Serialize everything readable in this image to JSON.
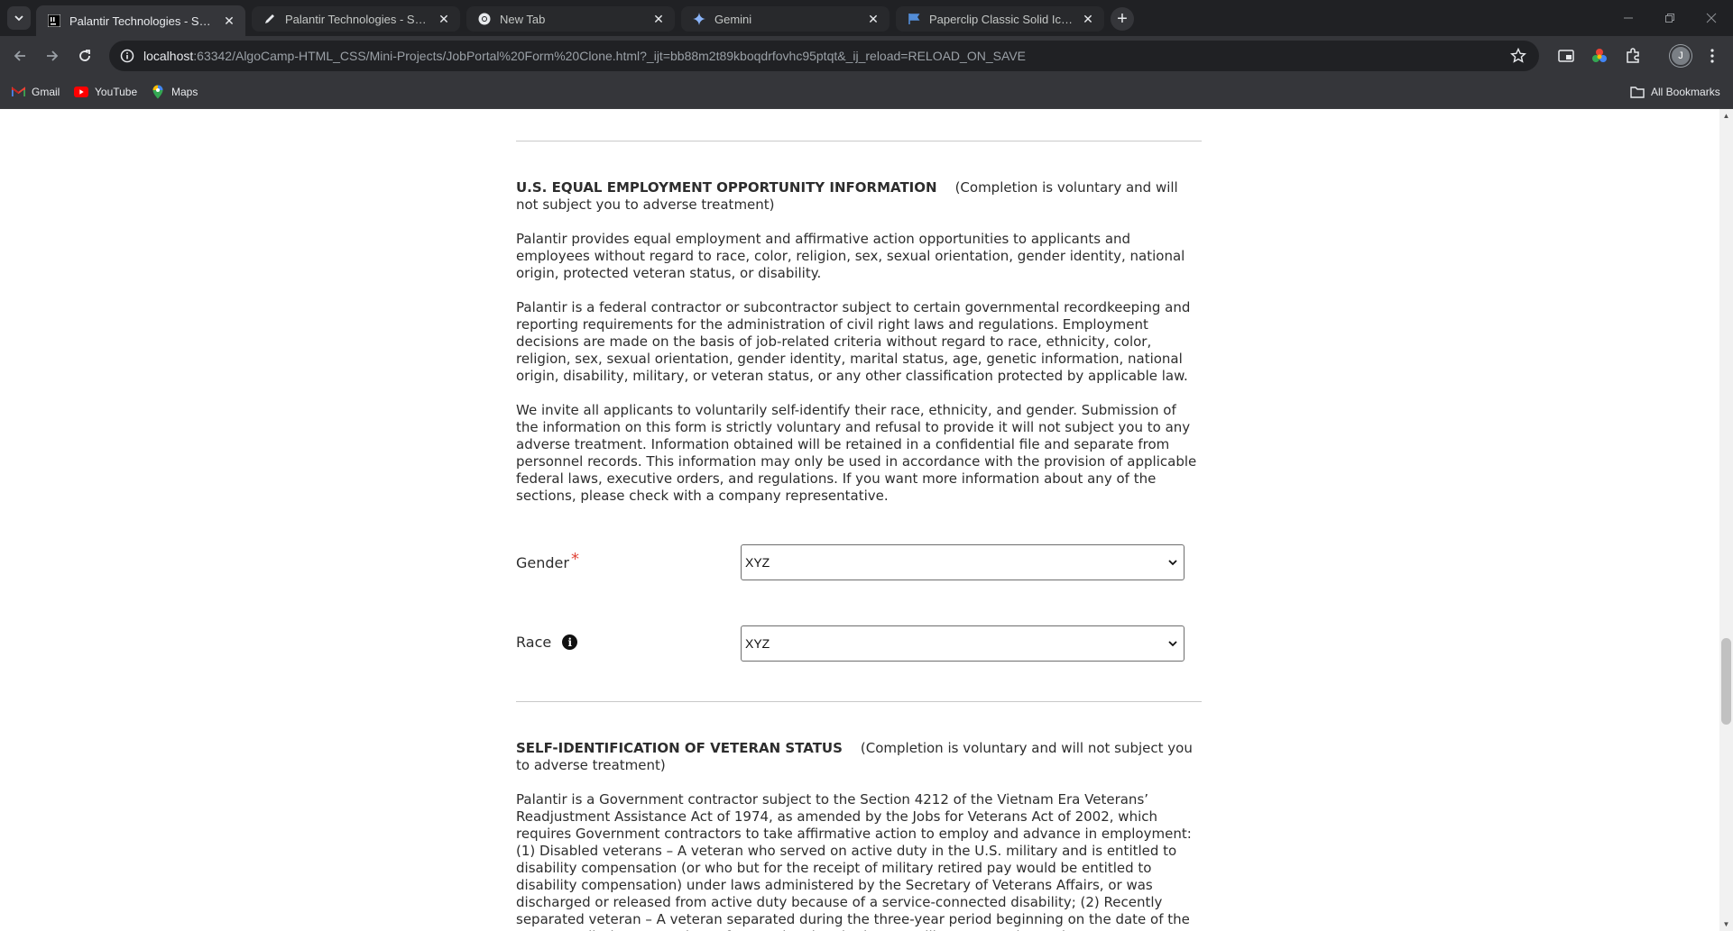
{
  "browser": {
    "tabs": [
      {
        "title": "Palantir Technologies - Software",
        "icon": "intellij-icon",
        "active": true
      },
      {
        "title": "Palantir Technologies - Software",
        "icon": "pen-icon",
        "active": false
      },
      {
        "title": "New Tab",
        "icon": "chrome-icon",
        "active": false
      },
      {
        "title": "Gemini",
        "icon": "gemini-icon",
        "active": false
      },
      {
        "title": "Paperclip Classic Solid Icon | Fo",
        "icon": "fontawesome-flag-icon",
        "active": false
      }
    ],
    "url_host": "localhost",
    "url_rest": ":63342/AlgoCamp-HTML_CSS/Mini-Projects/JobPortal%20Form%20Clone.html?_ijt=bb88m2t89kboqdrfovhc95ptqt&_ij_reload=RELOAD_ON_SAVE",
    "bookmarks": [
      {
        "label": "Gmail",
        "icon": "gmail-icon"
      },
      {
        "label": "YouTube",
        "icon": "youtube-icon"
      },
      {
        "label": "Maps",
        "icon": "maps-icon"
      }
    ],
    "all_bookmarks": "All Bookmarks",
    "profile_initial": "J"
  },
  "eeo": {
    "heading": "U.S. EQUAL EMPLOYMENT OPPORTUNITY INFORMATION",
    "note": "(Completion is voluntary and will not subject you to adverse treatment)",
    "p1": "Palantir provides equal employment and affirmative action opportunities to applicants and employees without regard to race, color, religion, sex, sexual orientation, gender identity, national origin, protected veteran status, or disability.",
    "p2": "Palantir is a federal contractor or subcontractor subject to certain governmental recordkeeping and reporting requirements for the administration of civil right laws and regulations. Employment decisions are made on the basis of job-related criteria without regard to race, ethnicity, color, religion, sex, sexual orientation, gender identity, marital status, age, genetic information, national origin, disability, military, or veteran status, or any other classification protected by applicable law.",
    "p3": "We invite all applicants to voluntarily self-identify their race, ethnicity, and gender. Submission of the information on this form is strictly voluntary and refusal to provide it will not subject you to any adverse treatment. Information obtained will be retained in a confidential file and separate from personnel records. This information may only be used in accordance with the provision of applicable federal laws, executive orders, and regulations. If you want more information about any of the sections, please check with a company representative.",
    "gender_label": "Gender",
    "required_mark": "*",
    "gender_value": "XYZ",
    "race_label": "Race",
    "race_value": "XYZ"
  },
  "veteran": {
    "heading": "SELF-IDENTIFICATION OF VETERAN STATUS",
    "note": "(Completion is voluntary and will not subject you to adverse treatment)",
    "p1": "Palantir is a Government contractor subject to the Section 4212 of the Vietnam Era Veterans’ Readjustment Assistance Act of 1974, as amended by the Jobs for Veterans Act of 2002, which requires Government contractors to take affirmative action to employ and advance in employment: (1) Disabled veterans – A veteran who served on active duty in the U.S. military and is entitled to disability compensation (or who but for the receipt of military retired pay would be entitled to disability compensation) under laws administered by the Secretary of Veterans Affairs, or was discharged or released from active duty because of a service-connected disability; (2) Recently separated veteran – A veteran separated during the three-year period beginning on the date of the veteran's discharge or release from active duty in the U.S military, ground, naval,"
  }
}
